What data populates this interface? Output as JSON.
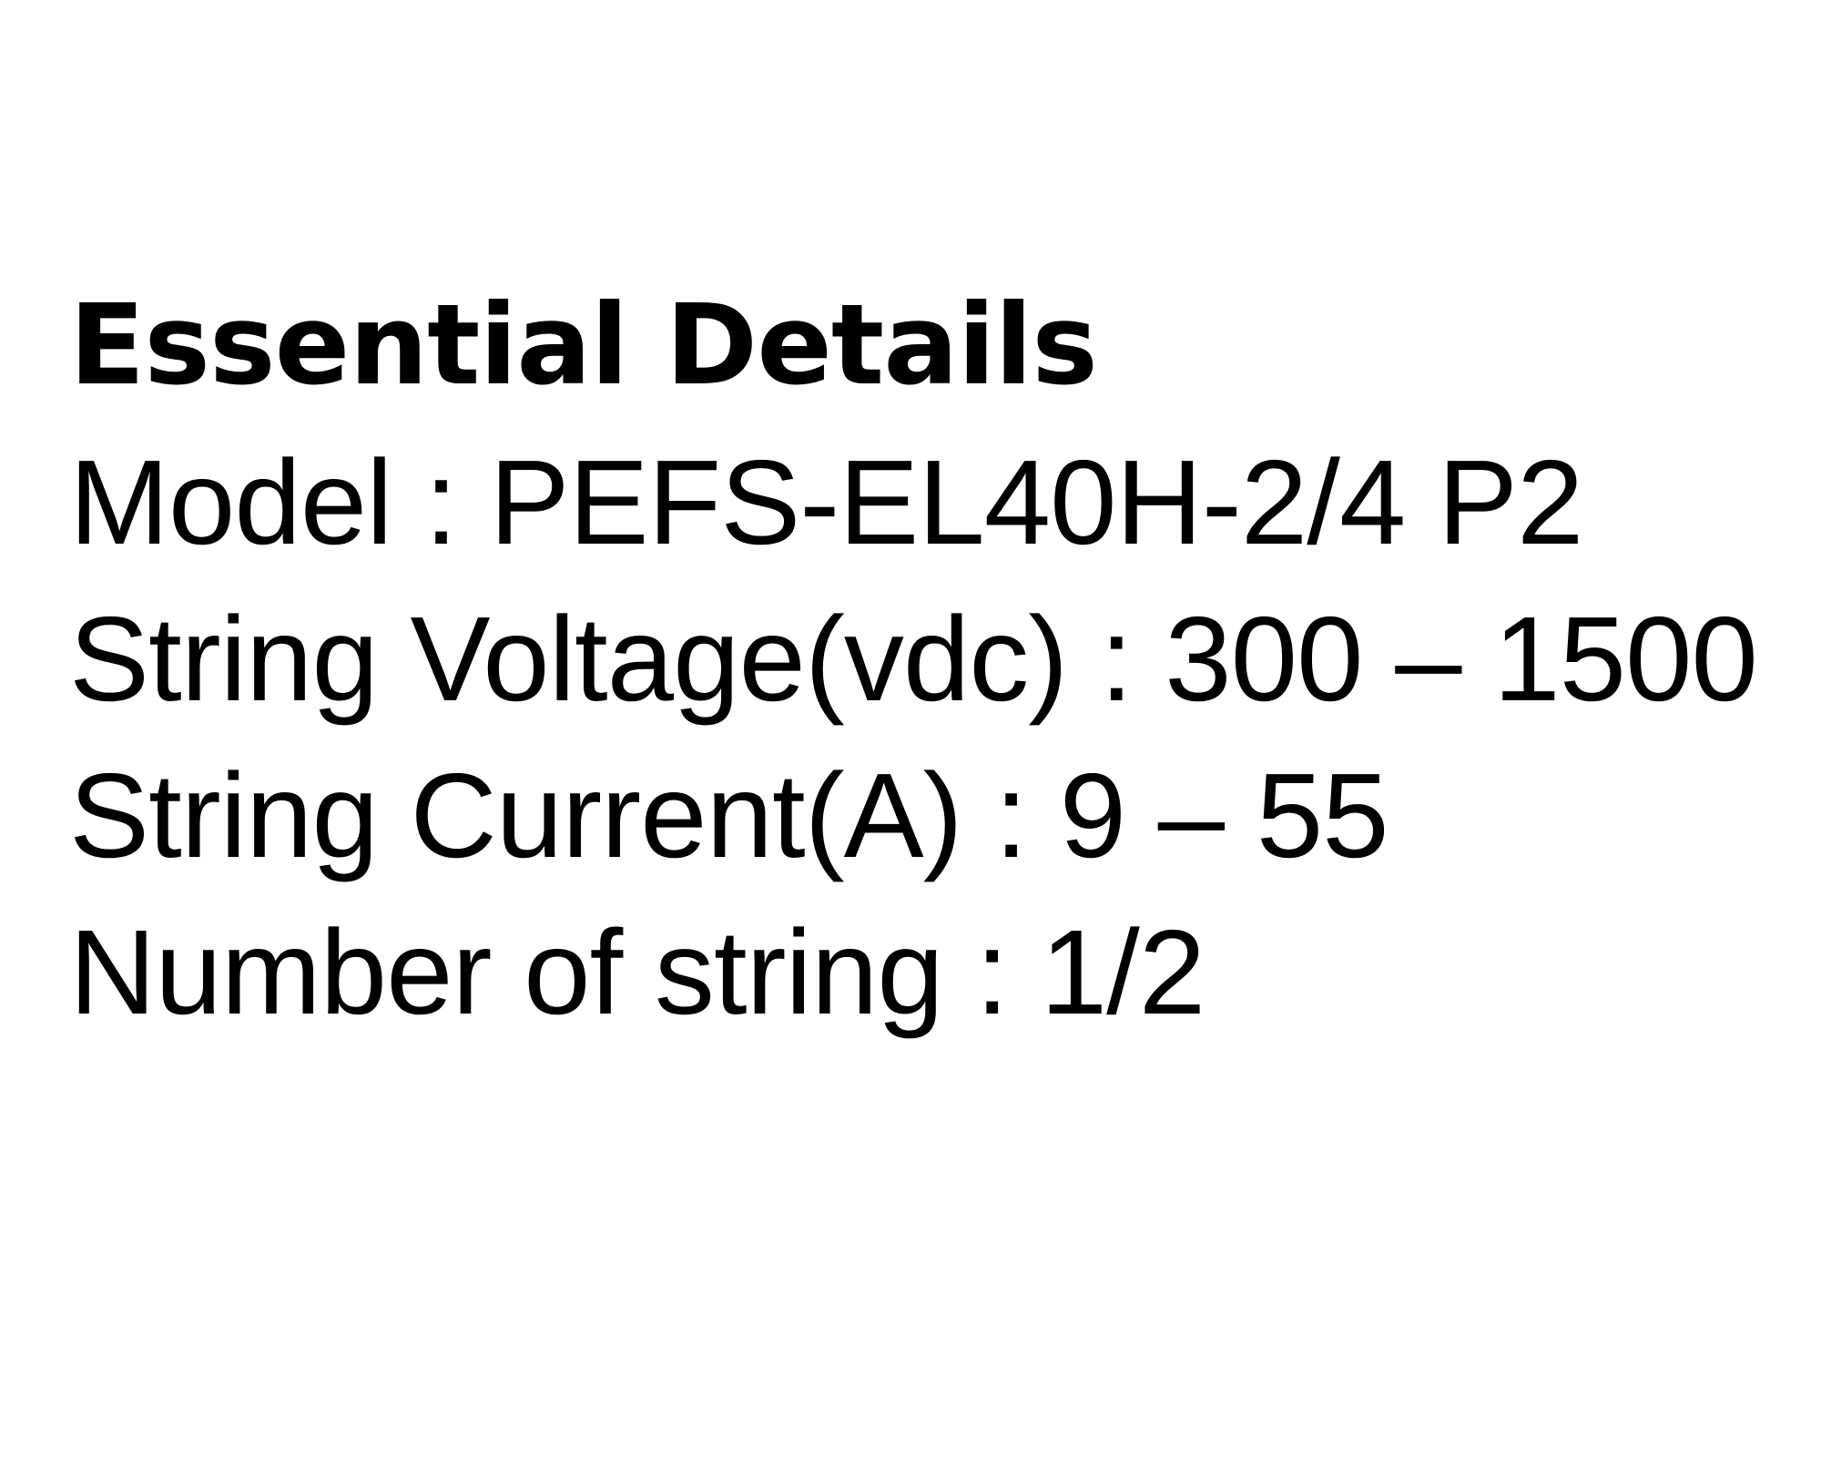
{
  "details": {
    "title": "Essential Details",
    "lines": [
      "Model : PEFS-EL40H-2/4 P2",
      "String Voltage(vdc) : 300 – 1500",
      "String Current(A) : 9 – 55",
      "Number of string : 1/2"
    ]
  }
}
